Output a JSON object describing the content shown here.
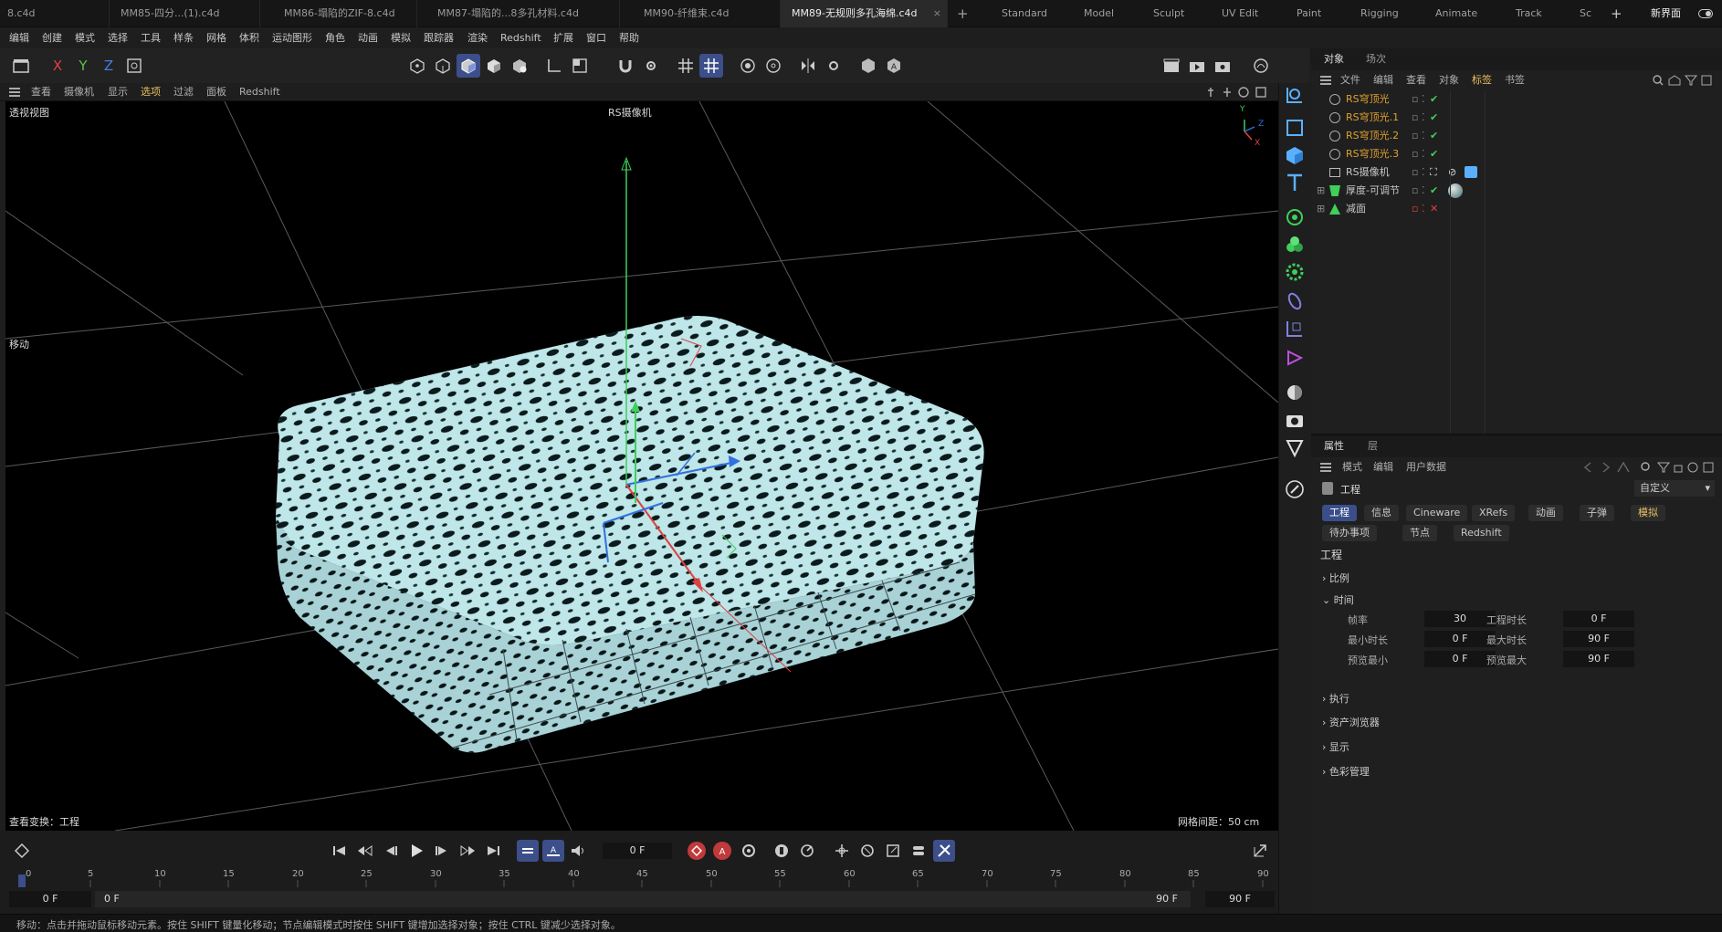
{
  "file_tabs": [
    {
      "label": "8.c4d"
    },
    {
      "label": "MM85-四分...(1).c4d"
    },
    {
      "label": "MM86-塌陷的ZIF-8.c4d"
    },
    {
      "label": "MM87-塌陷的...8多孔材料.c4d"
    },
    {
      "label": "MM90-纤维束.c4d"
    },
    {
      "label": "MM89-无规则多孔海绵.c4d",
      "active": true
    }
  ],
  "close_glyph": "×",
  "add_glyph": "+",
  "layouts": [
    "Standard",
    "Model",
    "Sculpt",
    "UV Edit",
    "Paint",
    "Rigging",
    "Animate",
    "Track",
    "Sc"
  ],
  "new_layout": "新界面",
  "menu": [
    "编辑",
    "创建",
    "模式",
    "选择",
    "工具",
    "样条",
    "网格",
    "体积",
    "运动图形",
    "角色",
    "动画",
    "模拟",
    "跟踪器",
    "渲染",
    "Redshift",
    "扩展",
    "窗口",
    "帮助"
  ],
  "axis_buttons": [
    "X",
    "Y",
    "Z"
  ],
  "viewport_menu": [
    "查看",
    "摄像机",
    "显示",
    "选项",
    "过滤",
    "面板",
    "Redshift"
  ],
  "viewport": {
    "name": "透视视图",
    "camera": "RS摄像机",
    "tool": "移动",
    "transform": "查看变换：工程",
    "grid_spacing": "网格间距：50 cm",
    "axis_labels": [
      "Y",
      "Z",
      "X"
    ]
  },
  "object_panel": {
    "tabs": [
      "对象",
      "场次"
    ],
    "menu": [
      "文件",
      "编辑",
      "查看",
      "对象",
      "标签",
      "书签"
    ],
    "objects": [
      {
        "name": "RS穹顶光",
        "color": "orange",
        "tag": "check"
      },
      {
        "name": "RS穹顶光.1",
        "color": "orange",
        "tag": "check"
      },
      {
        "name": "RS穹顶光.2",
        "color": "orange",
        "tag": "check"
      },
      {
        "name": "RS穹顶光.3",
        "color": "orange",
        "tag": "check"
      },
      {
        "name": "RS摄像机",
        "color": "white",
        "tag": "camera"
      },
      {
        "name": "厚度-可调节",
        "color": "white",
        "tag": "material"
      },
      {
        "name": "减面",
        "color": "white",
        "tag": "cross"
      }
    ]
  },
  "attr_panel": {
    "tabs": [
      "属性",
      "层"
    ],
    "menu": [
      "模式",
      "编辑",
      "用户数据"
    ],
    "object": "工程",
    "preset": "自定义",
    "buttons_row1": [
      "工程",
      "信息",
      "Cineware",
      "XRefs",
      "动画",
      "子弹",
      "模拟"
    ],
    "buttons_row2": [
      "待办事项",
      "节点",
      "Redshift"
    ],
    "heading": "工程",
    "sections": [
      "比例",
      "时间",
      "执行",
      "资产浏览器",
      "显示",
      "色彩管理"
    ],
    "fields": [
      {
        "label": "帧率",
        "value": "30"
      },
      {
        "label": "工程时长",
        "value": "0 F"
      },
      {
        "label": "最小时长",
        "value": "0 F"
      },
      {
        "label": "最大时长",
        "value": "90 F"
      },
      {
        "label": "预览最小",
        "value": "0 F"
      },
      {
        "label": "预览最大",
        "value": "90 F"
      }
    ]
  },
  "timeline": {
    "current_frame": "0 F",
    "ticks": [
      "0",
      "5",
      "10",
      "15",
      "20",
      "25",
      "30",
      "35",
      "40",
      "45",
      "50",
      "55",
      "60",
      "65",
      "70",
      "75",
      "80",
      "85",
      "90"
    ],
    "range_start": "0 F",
    "range_start2": "0 F",
    "range_end": "90 F",
    "range_end2": "90 F"
  },
  "status": "移动：点击并拖动鼠标移动元素。按住 SHIFT 键量化移动；节点编辑模式时按住 SHIFT 键增加选择对象；按住 CTRL 键减少选择对象。",
  "colors": {
    "accent": "#3c4f8a",
    "orange": "#e0a030",
    "green": "#3fcf5a",
    "red": "#e04040",
    "sponge": "#bfe6e8"
  }
}
